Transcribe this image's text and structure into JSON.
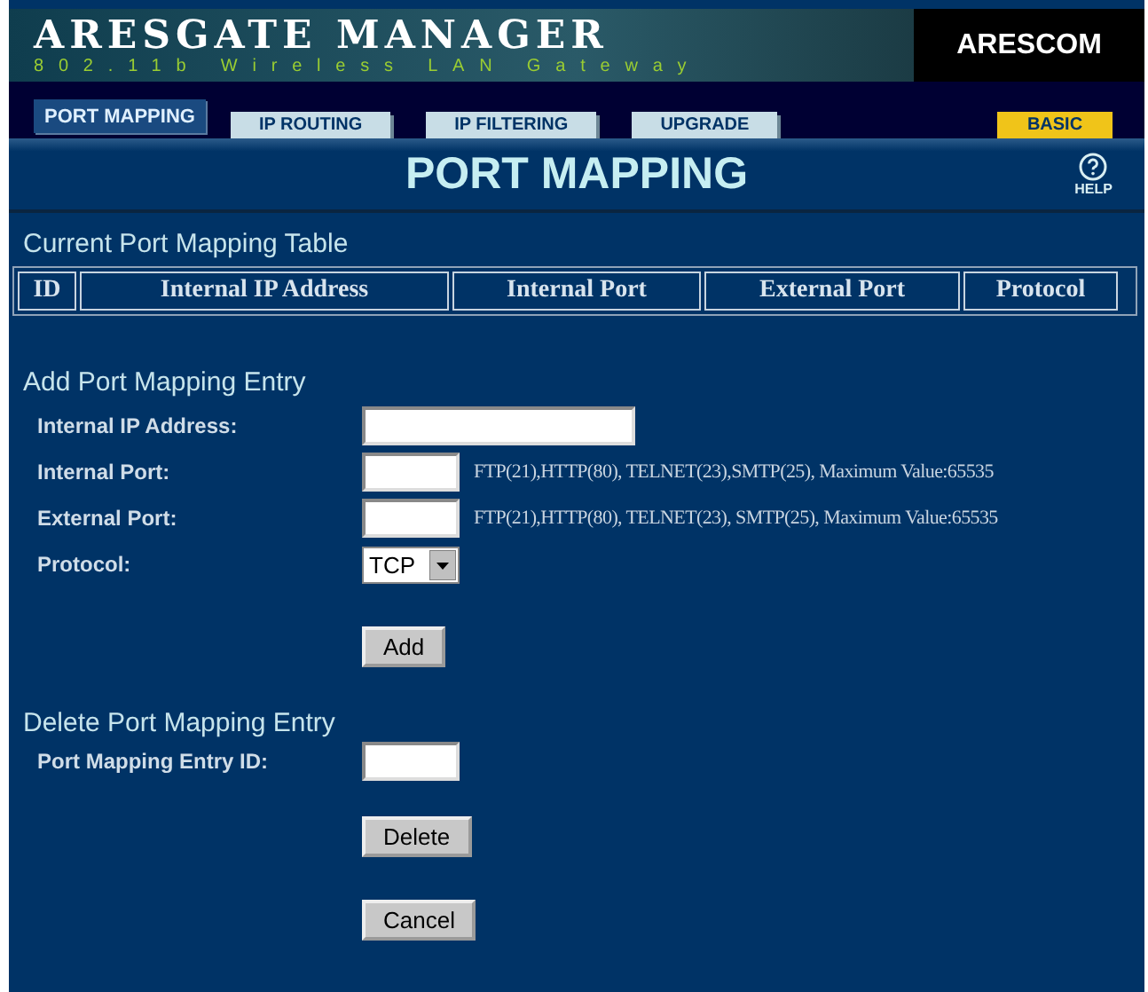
{
  "header": {
    "title": "ARESGATE MANAGER",
    "subtitle": "802.11b Wireless LAN Gateway",
    "brand": "ARESCOM"
  },
  "tabs": [
    {
      "label": "PORT MAPPING",
      "selected": true
    },
    {
      "label": "IP ROUTING",
      "selected": false
    },
    {
      "label": "IP FILTERING",
      "selected": false
    },
    {
      "label": "UPGRADE",
      "selected": false
    }
  ],
  "mode_button": "BASIC",
  "page_title": "PORT MAPPING",
  "help": "HELP",
  "table": {
    "title": "Current Port Mapping Table",
    "columns": [
      "ID",
      "Internal IP Address",
      "Internal Port",
      "External Port",
      "Protocol"
    ]
  },
  "add_section": {
    "title": "Add Port Mapping Entry",
    "fields": [
      {
        "kind": "text",
        "label": "Internal IP Address:"
      },
      {
        "kind": "port",
        "label": "Internal Port:",
        "hint": "FTP(21),HTTP(80), TELNET(23),SMTP(25), Maximum Value:65535"
      },
      {
        "kind": "port",
        "label": "External Port:",
        "hint": "FTP(21),HTTP(80), TELNET(23), SMTP(25), Maximum Value:65535"
      },
      {
        "kind": "select",
        "label": "Protocol:",
        "value": "TCP"
      }
    ],
    "button": "Add"
  },
  "delete_section": {
    "title": "Delete Port Mapping Entry",
    "field_label": "Port Mapping Entry ID:",
    "button": "Delete"
  },
  "cancel_button": "Cancel"
}
